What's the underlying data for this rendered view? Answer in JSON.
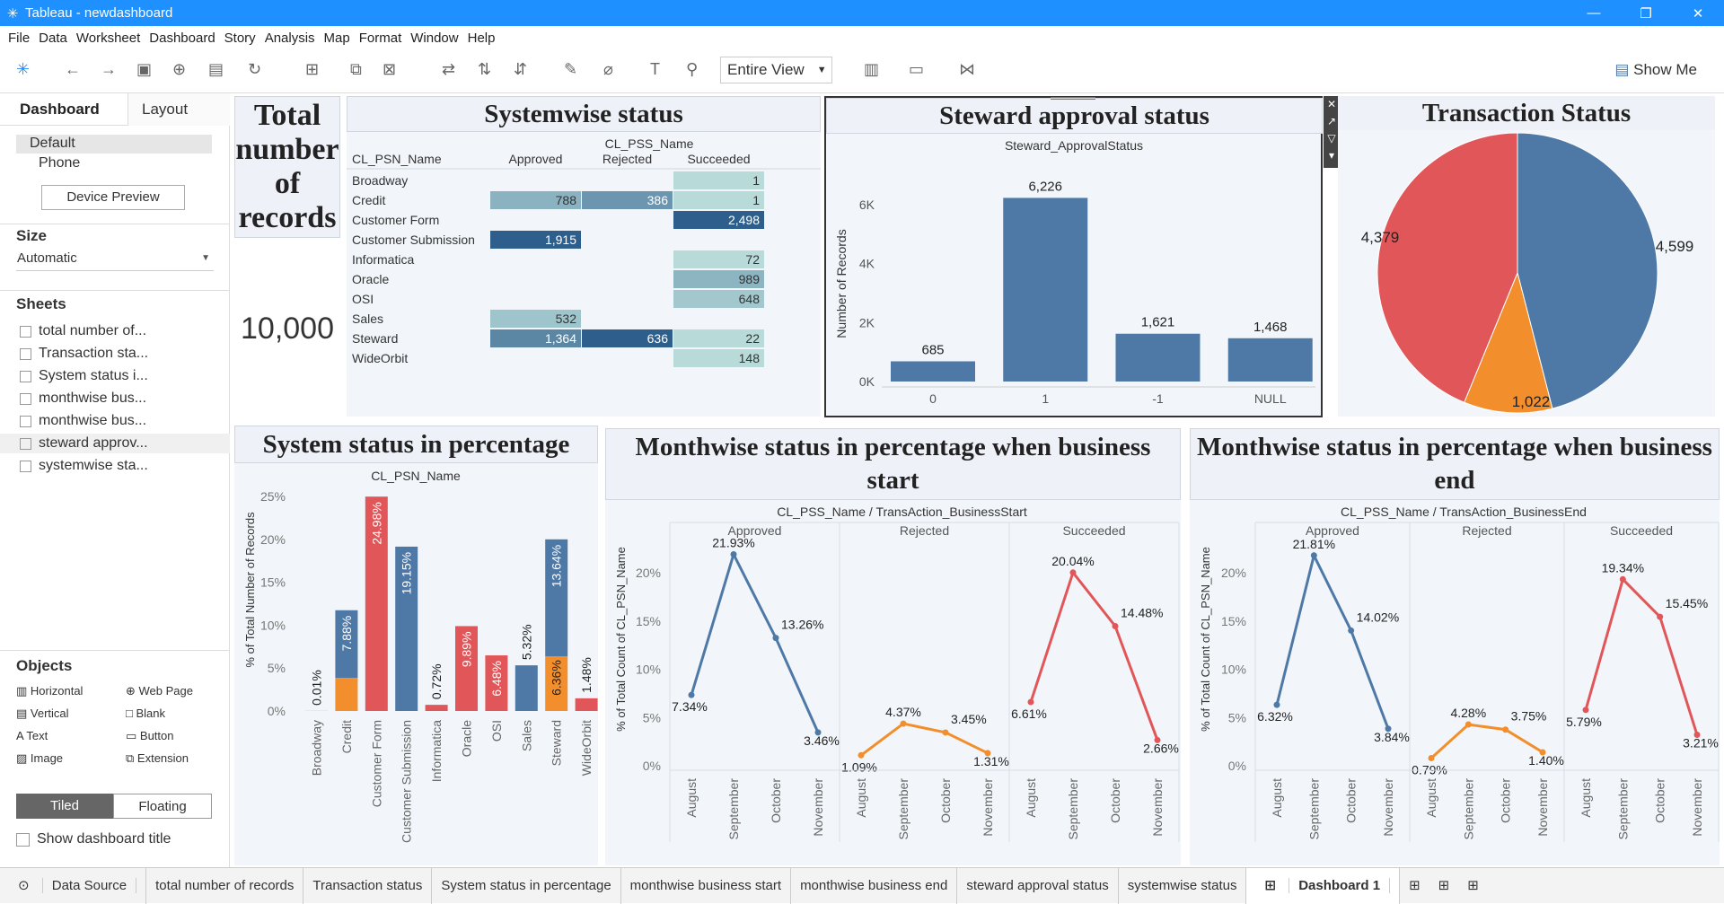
{
  "app": {
    "title": "Tableau - newdashboard"
  },
  "menu": [
    "File",
    "Data",
    "Worksheet",
    "Dashboard",
    "Story",
    "Analysis",
    "Map",
    "Format",
    "Window",
    "Help"
  ],
  "toolbar": {
    "fit_label": "Entire View",
    "show_me": "Show Me"
  },
  "left": {
    "tab_dashboard": "Dashboard",
    "tab_layout": "Layout",
    "device_default": "Default",
    "device_phone": "Phone",
    "device_preview": "Device Preview",
    "size_title": "Size",
    "size_value": "Automatic",
    "sheets_title": "Sheets",
    "sheets": [
      "total number of...",
      "Transaction sta...",
      "System status i...",
      "monthwise bus...",
      "monthwise bus...",
      "steward approv...",
      "systemwise sta..."
    ],
    "objects_title": "Objects",
    "objects": [
      "Horizontal",
      "Web Page",
      "Vertical",
      "Blank",
      "Text",
      "Button",
      "Image",
      "Extension"
    ],
    "tiled": "Tiled",
    "floating": "Floating",
    "show_title": "Show dashboard title"
  },
  "total": {
    "title": "Total number of records",
    "title_lines": [
      "Total",
      "number",
      "of",
      "records"
    ],
    "value": "10,000"
  },
  "systemwise": {
    "title": "Systemwise status",
    "col_header": "CL_PSS_Name",
    "row_header": "CL_PSN_Name",
    "columns": [
      "Approved",
      "Rejected",
      "Succeeded"
    ],
    "rows": [
      {
        "name": "Broadway",
        "values": [
          "",
          "",
          "1"
        ]
      },
      {
        "name": "Credit",
        "values": [
          "788",
          "386",
          "1"
        ]
      },
      {
        "name": "Customer Form",
        "values": [
          "",
          "",
          "2,498"
        ]
      },
      {
        "name": "Customer Submission",
        "values": [
          "1,915",
          "",
          ""
        ]
      },
      {
        "name": "Informatica",
        "values": [
          "",
          "",
          "72"
        ]
      },
      {
        "name": "Oracle",
        "values": [
          "",
          "",
          "989"
        ]
      },
      {
        "name": "OSI",
        "values": [
          "",
          "",
          "648"
        ]
      },
      {
        "name": "Sales",
        "values": [
          "532",
          "",
          ""
        ]
      },
      {
        "name": "Steward",
        "values": [
          "1,364",
          "636",
          "22"
        ]
      },
      {
        "name": "WideOrbit",
        "values": [
          "",
          "",
          "148"
        ]
      }
    ]
  },
  "steward": {
    "title": "Steward approval status",
    "subtitle": "Steward_ApprovalStatus",
    "ylabel": "Number of Records",
    "yticks": [
      "6K",
      "4K",
      "2K",
      "0K"
    ]
  },
  "transaction": {
    "title": "Transaction Status"
  },
  "sys_pct": {
    "title": "System status in percentage",
    "subtitle": "CL_PSN_Name",
    "ylabel": "% of Total Number of Records",
    "yticks": [
      "25%",
      "20%",
      "15%",
      "10%",
      "5%",
      "0%"
    ]
  },
  "month_start": {
    "title": "Monthwise status in percentage when business start",
    "subtitle": "CL_PSS_Name / TransAction_BusinessStart",
    "ylabel": "% of Total Count of CL_PSN_Name",
    "yticks": [
      "20%",
      "15%",
      "10%",
      "5%",
      "0%"
    ]
  },
  "month_end": {
    "title": "Monthwise status in percentage when business end",
    "subtitle": "CL_PSS_Name / TransAction_BusinessEnd",
    "ylabel": "% of Total Count of CL_PSN_Name",
    "yticks": [
      "20%",
      "15%",
      "10%",
      "5%",
      "0%"
    ]
  },
  "tabs": [
    "Data Source",
    "total number of records",
    "Transaction status",
    "System status in percentage",
    "monthwise business start",
    "monthwise business end",
    "steward approval status",
    "systemwise status",
    "Dashboard 1"
  ],
  "chart_data": [
    {
      "type": "bar",
      "title": "Steward approval status",
      "xlabel": "Steward_ApprovalStatus",
      "ylabel": "Number of Records",
      "categories": [
        "0",
        "1",
        "-1",
        "NULL"
      ],
      "values": [
        685,
        6226,
        1621,
        1468
      ],
      "ylim": [
        0,
        7000
      ],
      "color": "#4e79a7"
    },
    {
      "type": "pie",
      "title": "Transaction Status",
      "slices": [
        {
          "value": 4599,
          "color": "#4e79a7",
          "label": "4,599"
        },
        {
          "value": 1022,
          "color": "#f28e2b",
          "label": "1,022"
        },
        {
          "value": 4379,
          "color": "#e15759",
          "label": "4,379"
        }
      ]
    },
    {
      "type": "bar",
      "title": "System status in percentage",
      "xlabel": "CL_PSN_Name",
      "ylabel": "% of Total Number of Records",
      "categories": [
        "Broadway",
        "Credit",
        "Customer Form",
        "Customer Submission",
        "Informatica",
        "Oracle",
        "OSI",
        "Sales",
        "Steward",
        "WideOrbit"
      ],
      "ylim": [
        0,
        25
      ],
      "series": [
        {
          "color": "#e15759",
          "values": [
            0,
            0,
            24.98,
            0,
            0.72,
            9.89,
            6.48,
            0,
            0,
            1.48
          ]
        },
        {
          "color": "#f28e2b",
          "values": [
            0,
            3.86,
            0,
            0,
            0,
            0,
            0,
            0,
            6.36,
            0
          ]
        },
        {
          "color": "#4e79a7",
          "values": [
            0.01,
            7.88,
            0,
            19.15,
            0,
            0,
            0,
            5.32,
            13.64,
            0
          ]
        }
      ],
      "labels": [
        "0.01%",
        "7.88%",
        "24.98%",
        "19.15%",
        "0.72%",
        "9.89%",
        "6.48%",
        "5.32%",
        "13.64%",
        "1.48%"
      ],
      "extra_labels": [
        {
          "index": 8,
          "text": "6.36%"
        }
      ]
    },
    {
      "type": "line",
      "title": "Monthwise status in percentage when business start",
      "x": [
        "August",
        "September",
        "October",
        "November"
      ],
      "ylim": [
        0,
        23
      ],
      "series": [
        {
          "name": "Approved",
          "color": "#4e79a7",
          "values": [
            7.34,
            21.93,
            13.26,
            3.46
          ],
          "labels": [
            "7.34%",
            "21.93%",
            "13.26%",
            "3.46%"
          ]
        },
        {
          "name": "Rejected",
          "color": "#f28e2b",
          "values": [
            1.09,
            4.37,
            3.45,
            1.31
          ],
          "labels": [
            "1.09%",
            "4.37%",
            "3.45%",
            "1.31%"
          ]
        },
        {
          "name": "Succeeded",
          "color": "#e15759",
          "values": [
            6.61,
            20.04,
            14.48,
            2.66
          ],
          "labels": [
            "6.61%",
            "20.04%",
            "14.48%",
            "2.66%"
          ]
        }
      ]
    },
    {
      "type": "line",
      "title": "Monthwise status in percentage when business end",
      "x": [
        "August",
        "September",
        "October",
        "November"
      ],
      "ylim": [
        0,
        23
      ],
      "series": [
        {
          "name": "Approved",
          "color": "#4e79a7",
          "values": [
            6.32,
            21.81,
            14.02,
            3.84
          ],
          "labels": [
            "6.32%",
            "21.81%",
            "14.02%",
            "3.84%"
          ]
        },
        {
          "name": "Rejected",
          "color": "#f28e2b",
          "values": [
            0.79,
            4.28,
            3.75,
            1.4
          ],
          "labels": [
            "0.79%",
            "4.28%",
            "3.75%",
            "1.40%"
          ]
        },
        {
          "name": "Succeeded",
          "color": "#e15759",
          "values": [
            5.79,
            19.34,
            15.45,
            3.21
          ],
          "labels": [
            "5.79%",
            "19.34%",
            "15.45%",
            "3.21%"
          ]
        }
      ]
    }
  ]
}
